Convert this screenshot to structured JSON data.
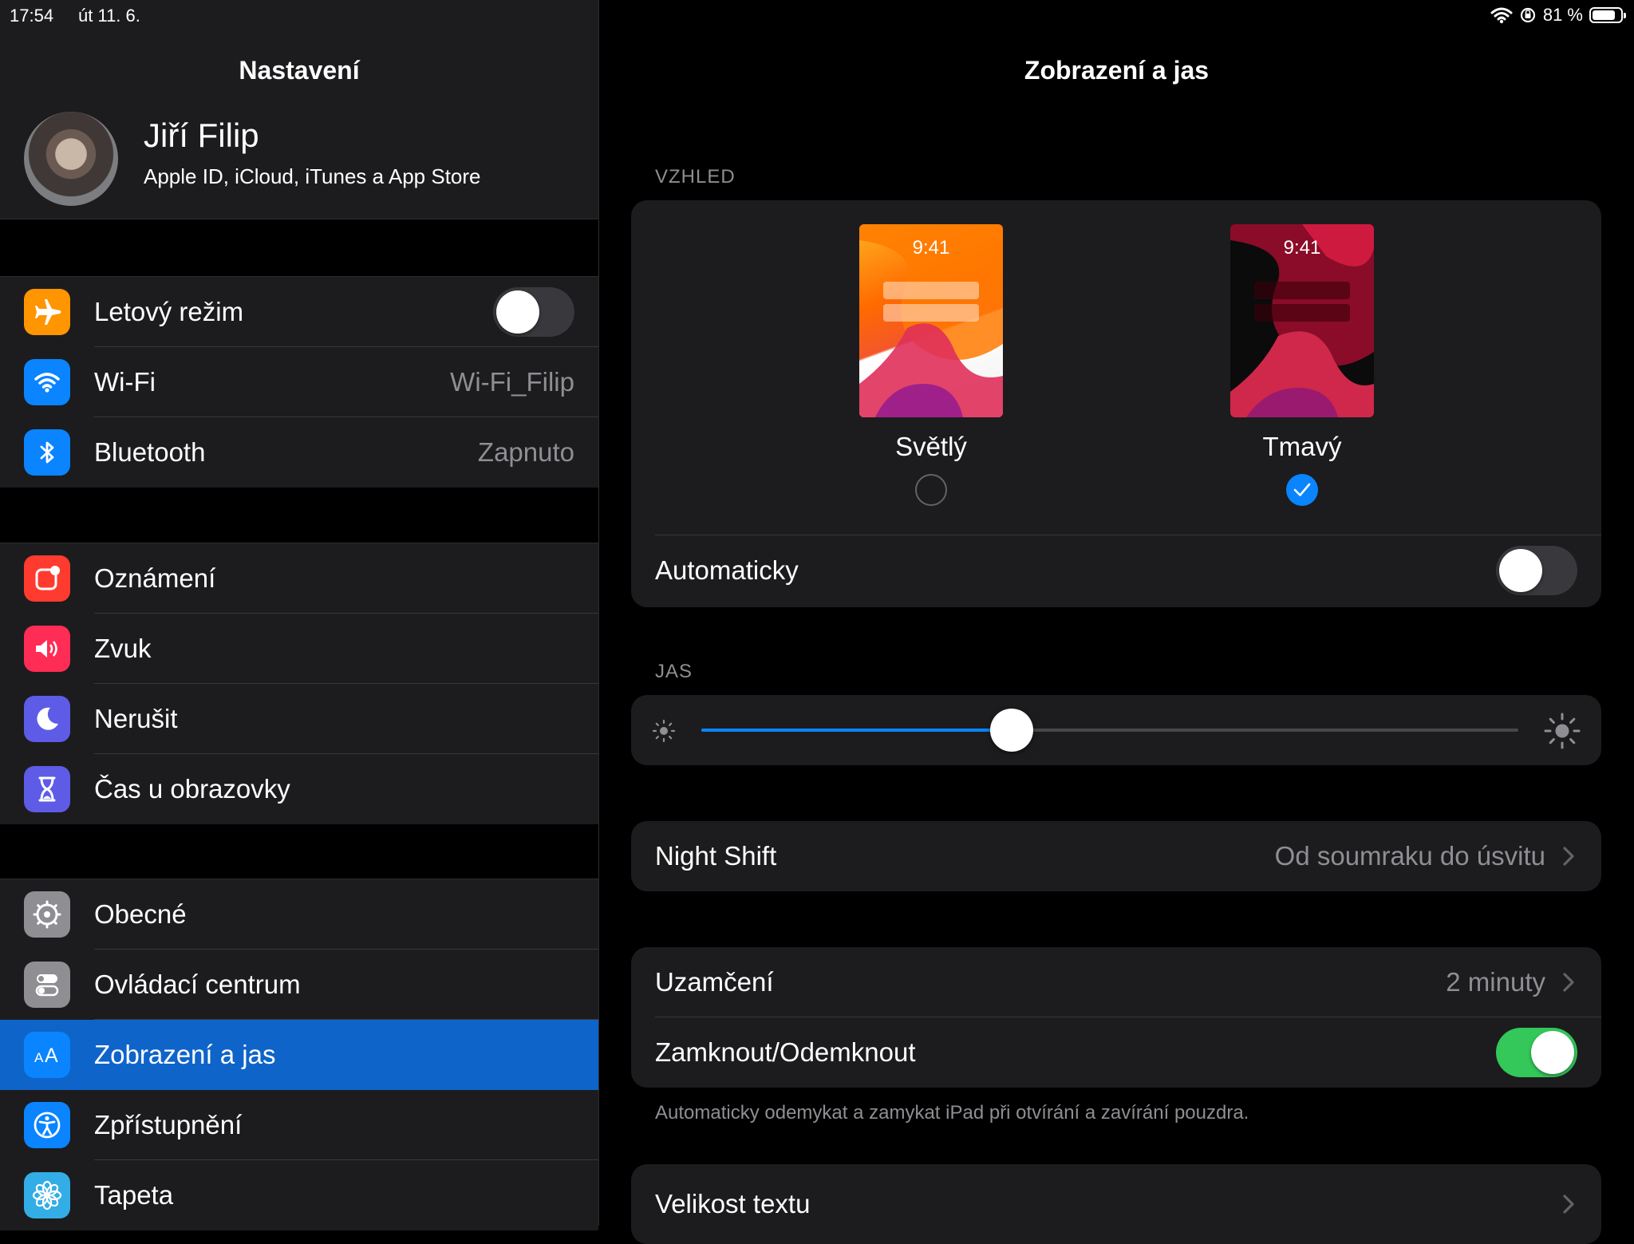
{
  "status_bar": {
    "time": "17:54",
    "date": "út 11. 6.",
    "battery_percent": "81 %",
    "battery_level": 0.81
  },
  "sidebar": {
    "title": "Nastavení",
    "profile": {
      "name": "Jiří Filip",
      "subtitle": "Apple ID, iCloud, iTunes a App Store"
    },
    "group1": [
      {
        "label": "Letový režim",
        "icon": "airplane-icon",
        "color": "#ff9500",
        "toggle": false
      },
      {
        "label": "Wi-Fi",
        "icon": "wifi-icon",
        "color": "#0a84ff",
        "value": "Wi-Fi_Filip"
      },
      {
        "label": "Bluetooth",
        "icon": "bluetooth-icon",
        "color": "#0a84ff",
        "value": "Zapnuto"
      }
    ],
    "group2": [
      {
        "label": "Oznámení",
        "icon": "notifications-icon",
        "color": "#ff3b30"
      },
      {
        "label": "Zvuk",
        "icon": "sound-icon",
        "color": "#ff2d55"
      },
      {
        "label": "Nerušit",
        "icon": "moon-icon",
        "color": "#5e5ce6"
      },
      {
        "label": "Čas u obrazovky",
        "icon": "hourglass-icon",
        "color": "#5e5ce6"
      }
    ],
    "group3": [
      {
        "label": "Obecné",
        "icon": "gear-icon",
        "color": "#8e8e93"
      },
      {
        "label": "Ovládací centrum",
        "icon": "switches-icon",
        "color": "#8e8e93"
      },
      {
        "label": "Zobrazení a jas",
        "icon": "text-size-icon",
        "color": "#0a84ff",
        "selected": true
      },
      {
        "label": "Zpřístupnění",
        "icon": "accessibility-icon",
        "color": "#0a84ff"
      },
      {
        "label": "Tapeta",
        "icon": "flower-icon",
        "color": "#32ade6"
      }
    ]
  },
  "main": {
    "title": "Zobrazení a jas",
    "appearance": {
      "section_label": "VZHLED",
      "light": {
        "label": "Světlý",
        "time": "9:41",
        "selected": false
      },
      "dark": {
        "label": "Tmavý",
        "time": "9:41",
        "selected": true
      },
      "automatic_label": "Automaticky",
      "automatic_on": false
    },
    "brightness": {
      "section_label": "JAS",
      "level": 0.38
    },
    "night_shift": {
      "label": "Night Shift",
      "value": "Od soumraku do úsvitu"
    },
    "lock": {
      "label": "Uzamčení",
      "value": "2 minuty"
    },
    "lock_unlock": {
      "label": "Zamknout/Odemknout",
      "on": true
    },
    "lock_footnote": "Automaticky odemykat a zamykat iPad při otvírání a zavírání pouzdra.",
    "text_size": {
      "label": "Velikost textu"
    },
    "colors": {
      "accent": "#0a84ff",
      "selected_row": "#0f64c9",
      "toggle_on": "#34c759"
    }
  }
}
